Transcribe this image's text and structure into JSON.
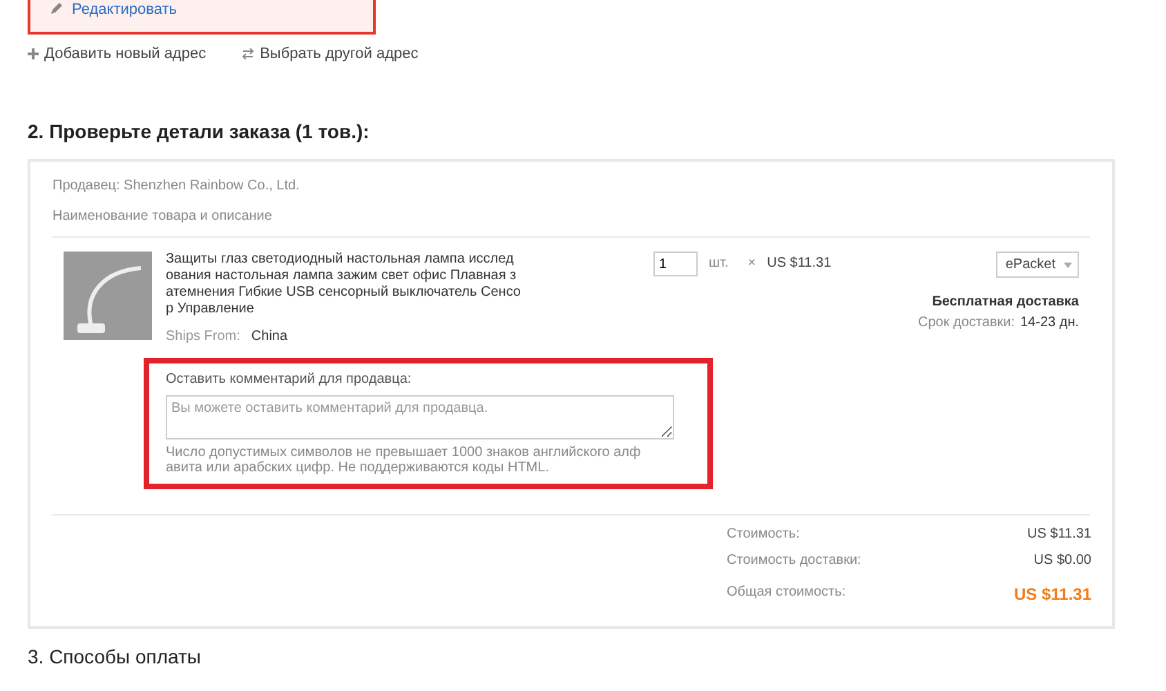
{
  "address": {
    "edit_link": "Редактировать",
    "actions": [
      {
        "kind": "add",
        "label": "Добавить новый адрес"
      },
      {
        "kind": "switch",
        "label": "Выбрать другой адрес"
      }
    ]
  },
  "order_section": {
    "title": "2. Проверьте детали заказа (1 тов.):",
    "seller": "Продавец: Shenzhen Rainbow Co., Ltd.",
    "column_heading": "Наименование товара и описание",
    "item": {
      "title_lines": [
        "Защиты глаз светодиодный настольная лампа исслед",
        "ования настольная лампа зажим свет офис Плавная з",
        "атемнения Гибкие USB сенсорный выключатель Сенсо",
        "р Управление"
      ],
      "ships_from_label": "Ships From:",
      "ships_from": "China",
      "quantity": "1",
      "unit": "шт.",
      "times": "×",
      "price": "US $11.31",
      "shipping_method": "ePacket",
      "shipping_note": "Бесплатная доставка",
      "delivery_label": "Срок доставки:",
      "delivery_time": "14-23 дн.",
      "comment": {
        "label": "Оставить комментарий для продавца:",
        "placeholder": "Вы можете оставить комментарий для продавца.",
        "hint_lines": [
          "Число допустимых символов не превышает 1000 знаков английского алф",
          "авита или арабских цифр. Не поддерживаются коды HTML."
        ]
      }
    },
    "summary": [
      {
        "kind": "plain",
        "label": "Стоимость:",
        "value": "US $11.31"
      },
      {
        "kind": "plain",
        "label": "Стоимость доставки:",
        "value": "US $0.00"
      },
      {
        "kind": "total",
        "label": "Общая стоимость:",
        "value": "US $11.31"
      }
    ]
  },
  "payment_section": {
    "title": "3. Способы оплаты"
  }
}
